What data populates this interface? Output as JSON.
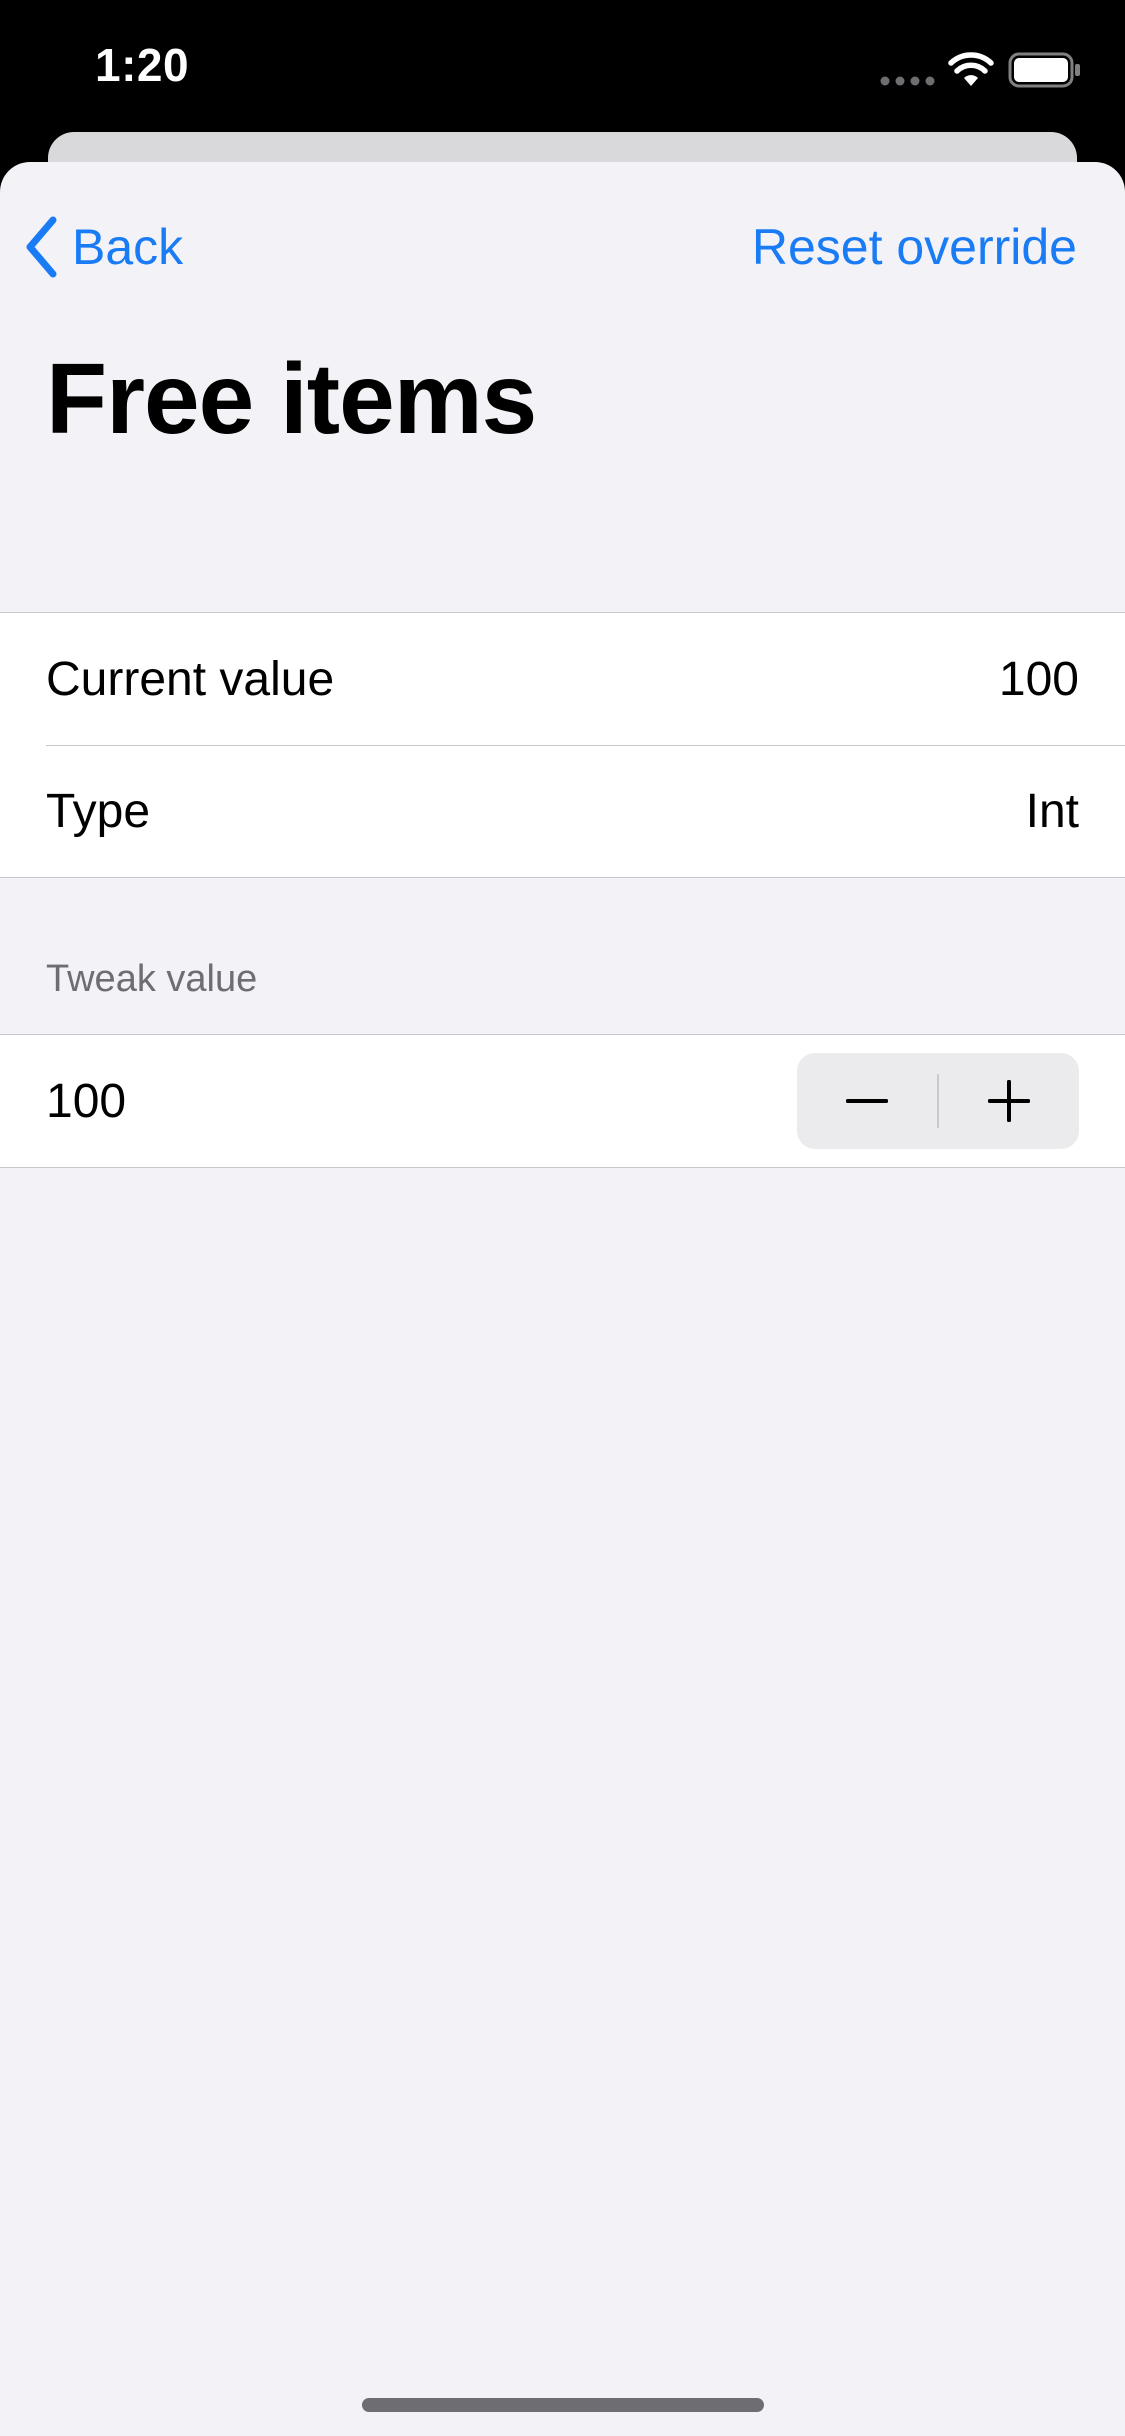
{
  "status_bar": {
    "time": "1:20",
    "icons": [
      "cellular-signal-icon",
      "wifi-icon",
      "battery-icon"
    ]
  },
  "nav": {
    "back_label": "Back",
    "reset_label": "Reset override",
    "accent_color": "#1a7cf5"
  },
  "title": "Free items",
  "info": {
    "current_value_label": "Current value",
    "current_value": "100",
    "type_label": "Type",
    "type_value": "Int"
  },
  "tweak": {
    "section_header": "Tweak value",
    "value": "100",
    "decrement_icon": "minus-icon",
    "increment_icon": "plus-icon"
  }
}
